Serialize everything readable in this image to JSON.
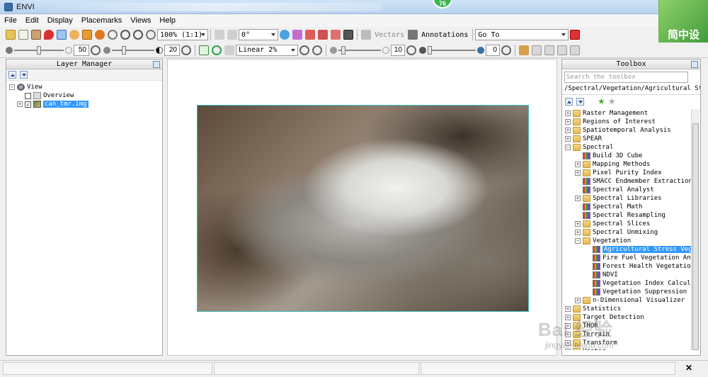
{
  "window": {
    "title": "ENVI",
    "notification_count": "76"
  },
  "overlay_logo": "简中设",
  "menu": [
    "File",
    "Edit",
    "Display",
    "Placemarks",
    "Views",
    "Help"
  ],
  "toolbar1": {
    "zoom_value": "100% (1:1)",
    "rotation_value": "0°",
    "vectors_label": "Vectors",
    "annotations_label": "Annotations",
    "goto_value": "Go To"
  },
  "toolbar2": {
    "brightness": "50",
    "contrast": "20",
    "stretch_value": "Linear 2%",
    "sharpen": "10",
    "transparency": "0"
  },
  "layer_manager": {
    "title": "Layer Manager",
    "tree": [
      {
        "label": "View",
        "level": 0
      },
      {
        "label": "Overview",
        "level": 1
      },
      {
        "label": "can_tmr.img",
        "level": 1,
        "selected": true
      }
    ]
  },
  "toolbox": {
    "title": "Toolbox",
    "search_placeholder": "Search the toolbox",
    "path": "/Spectral/Vegetation/Agricultural Stress Ve",
    "items": [
      {
        "label": "Raster Management",
        "type": "folder",
        "level": 0
      },
      {
        "label": "Regions of Interest",
        "type": "folder",
        "level": 0
      },
      {
        "label": "Spatiotemporal Analysis",
        "type": "folder",
        "level": 0
      },
      {
        "label": "SPEAR",
        "type": "folder",
        "level": 0
      },
      {
        "label": "Spectral",
        "type": "folder",
        "level": 0
      },
      {
        "label": "Build 3D Cube",
        "type": "tool",
        "level": 1
      },
      {
        "label": "Mapping Methods",
        "type": "folder",
        "level": 1
      },
      {
        "label": "Pixel Purity Index",
        "type": "folder",
        "level": 1
      },
      {
        "label": "SMACC Endmember Extraction",
        "type": "tool",
        "level": 1
      },
      {
        "label": "Spectral Analyst",
        "type": "tool",
        "level": 1
      },
      {
        "label": "Spectral Libraries",
        "type": "folder",
        "level": 1
      },
      {
        "label": "Spectral Math",
        "type": "tool",
        "level": 1
      },
      {
        "label": "Spectral Resampling",
        "type": "tool",
        "level": 1
      },
      {
        "label": "Spectral Slices",
        "type": "folder",
        "level": 1
      },
      {
        "label": "Spectral Unmixing",
        "type": "folder",
        "level": 1
      },
      {
        "label": "Vegetation",
        "type": "folder",
        "level": 1
      },
      {
        "label": "Agricultural Stress Vegetation",
        "type": "tool",
        "level": 2,
        "selected": true
      },
      {
        "label": "Fire Fuel Vegetation Analysis",
        "type": "tool",
        "level": 2
      },
      {
        "label": "Forest Health Vegetation Analysis",
        "type": "tool",
        "level": 2
      },
      {
        "label": "NDVI",
        "type": "tool",
        "level": 2
      },
      {
        "label": "Vegetation Index Calculator",
        "type": "tool",
        "level": 2
      },
      {
        "label": "Vegetation Suppression",
        "type": "tool",
        "level": 2
      },
      {
        "label": "n-Dimensional Visualizer",
        "type": "folder",
        "level": 1
      },
      {
        "label": "Statistics",
        "type": "folder",
        "level": 0
      },
      {
        "label": "Target Detection",
        "type": "folder",
        "level": 0
      },
      {
        "label": "THOR",
        "type": "folder",
        "level": 0
      },
      {
        "label": "Terrain",
        "type": "folder",
        "level": 0
      },
      {
        "label": "Transform",
        "type": "folder",
        "level": 0
      },
      {
        "label": "Vector",
        "type": "folder",
        "level": 0
      }
    ]
  },
  "watermark": {
    "text": "Bai 经验",
    "url": "jingyan.baidu.com"
  },
  "colors": {
    "selection": "#3399ff",
    "raster_border": "#39b9c0",
    "logo_green": "#3e9b3a"
  }
}
